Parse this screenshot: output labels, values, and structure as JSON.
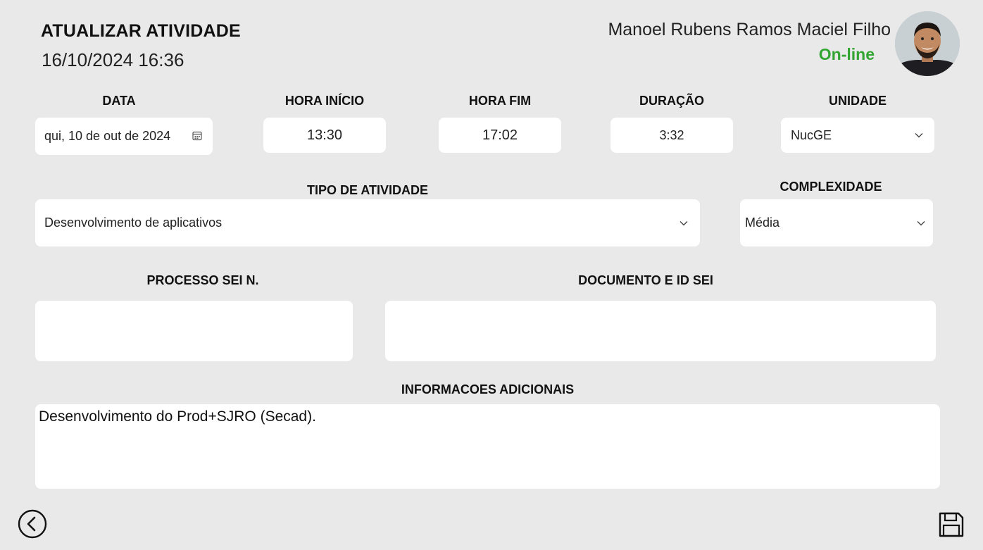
{
  "header": {
    "title": "ATUALIZAR ATIVIDADE",
    "datetime": "16/10/2024 16:36",
    "user_name": "Manoel Rubens Ramos Maciel Filho",
    "status": "On-line",
    "status_color": "#33a532"
  },
  "fields": {
    "data": {
      "label": "DATA",
      "value": "qui, 10 de out de 2024",
      "icon": "calendar-icon"
    },
    "hora_inicio": {
      "label": "HORA INÍCIO",
      "value": "13:30"
    },
    "hora_fim": {
      "label": "HORA FIM",
      "value": "17:02"
    },
    "duracao": {
      "label": "DURAÇÃO",
      "value": "3:32"
    },
    "unidade": {
      "label": "UNIDADE",
      "value": "NucGE",
      "icon": "chevron-down-icon"
    },
    "tipo_atividade": {
      "label": "TIPO DE ATIVIDADE",
      "value": "Desenvolvimento de aplicativos",
      "icon": "chevron-down-icon"
    },
    "complexidade": {
      "label": "COMPLEXIDADE",
      "value": "Média",
      "icon": "chevron-down-icon"
    },
    "processo_sei": {
      "label": "PROCESSO SEI N.",
      "value": ""
    },
    "documento_id_sei": {
      "label": "DOCUMENTO E ID SEI",
      "value": ""
    },
    "informacoes": {
      "label": "INFORMACOES ADICIONAIS",
      "value": "Desenvolvimento do Prod+SJRO (Secad)."
    }
  },
  "footer": {
    "back_icon": "back-arrow-circle-icon",
    "save_icon": "save-floppy-icon"
  }
}
